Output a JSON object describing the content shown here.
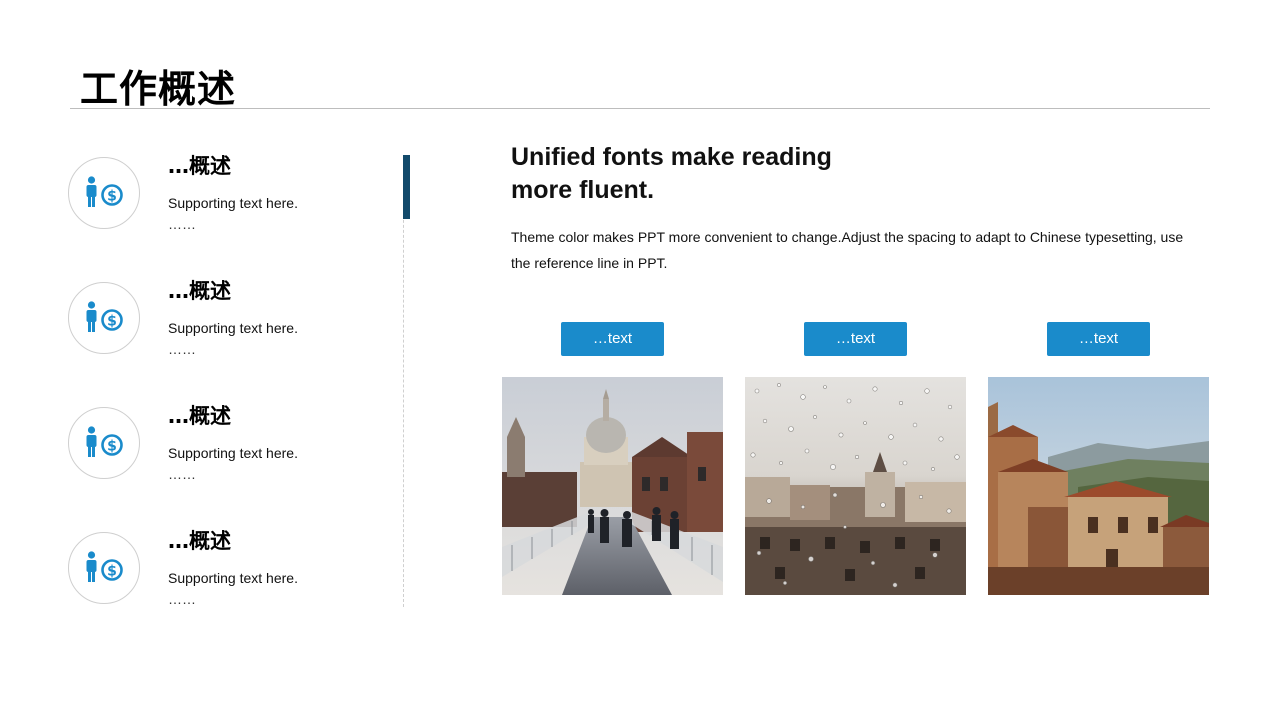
{
  "page": {
    "title": "工作概述"
  },
  "overview": {
    "items": [
      {
        "heading": "…概述",
        "text": "Supporting  text here.",
        "dots": "……"
      },
      {
        "heading": "…概述",
        "text": "Supporting  text here.",
        "dots": "……"
      },
      {
        "heading": "…概述",
        "text": "Supporting  text here.",
        "dots": "……"
      },
      {
        "heading": "…概述",
        "text": "Supporting  text here.",
        "dots": "……"
      }
    ]
  },
  "main": {
    "headline": "Unified fonts make reading more fluent.",
    "body": "Theme color makes PPT more convenient  to change.Adjust  the  spacing  to adapt to Chinese  typesetting, use the reference line  in  PPT."
  },
  "buttons": [
    {
      "label": "…text"
    },
    {
      "label": "…text"
    },
    {
      "label": "…text"
    }
  ],
  "photos": [
    {
      "name": "london-bridge-photo"
    },
    {
      "name": "rainy-window-city-photo"
    },
    {
      "name": "hillside-town-photo"
    }
  ],
  "colors": {
    "accent": "#1a8bcb",
    "divider_accent": "#124a6b",
    "rule": "#bdbdbd"
  },
  "icons": {
    "overview_item": "person-dollar-icon"
  }
}
